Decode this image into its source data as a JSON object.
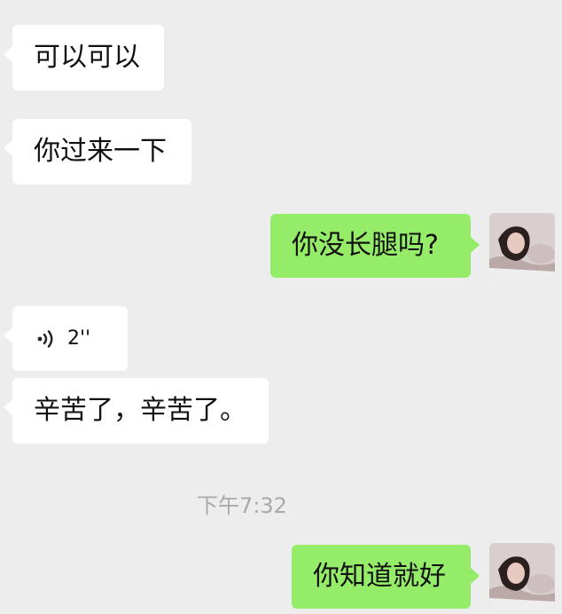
{
  "chat": {
    "messages": {
      "0": {
        "text": "可以可以"
      },
      "1": {
        "text": "你过来一下"
      },
      "2": {
        "text": "你没长腿吗?"
      },
      "3": {
        "duration": "2''"
      },
      "4": {
        "text": "辛苦了，辛苦了。"
      },
      "5": {
        "text": "你知道就好"
      }
    },
    "timestamp": "下午7:32"
  },
  "colors": {
    "background": "#ededed",
    "incoming_bubble": "#ffffff",
    "outgoing_bubble": "#95ec69",
    "timestamp_text": "#a9a9a9",
    "message_text": "#111111"
  },
  "icons": {
    "voice": "voice-wave-icon",
    "avatar": "avatar-photo"
  }
}
